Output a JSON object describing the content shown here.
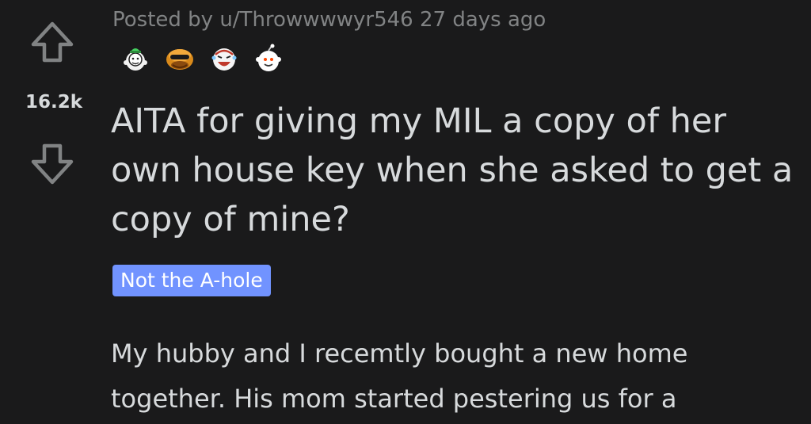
{
  "vote": {
    "score": "16.2k",
    "upvote_icon": "upvote-arrow-icon",
    "downvote_icon": "downvote-arrow-icon"
  },
  "post": {
    "meta": "Posted by u/Throwwwwyr546 27 days ago",
    "awards": [
      "helpful-award-icon",
      "ape-award-icon",
      "laughing-award-icon",
      "wholesome-award-icon"
    ],
    "title": "AITA for giving my MIL a copy of her own house key when she asked to get a copy of mine?",
    "flair": "Not the A-hole",
    "body": "My hubby and I recemtly bought a new home together. His mom started pestering us for a"
  },
  "colors": {
    "background": "#1a1a1b",
    "text": "#d7dadc",
    "meta_text": "#818384",
    "flair_bg": "#7193ff",
    "flair_text": "#ffffff"
  }
}
